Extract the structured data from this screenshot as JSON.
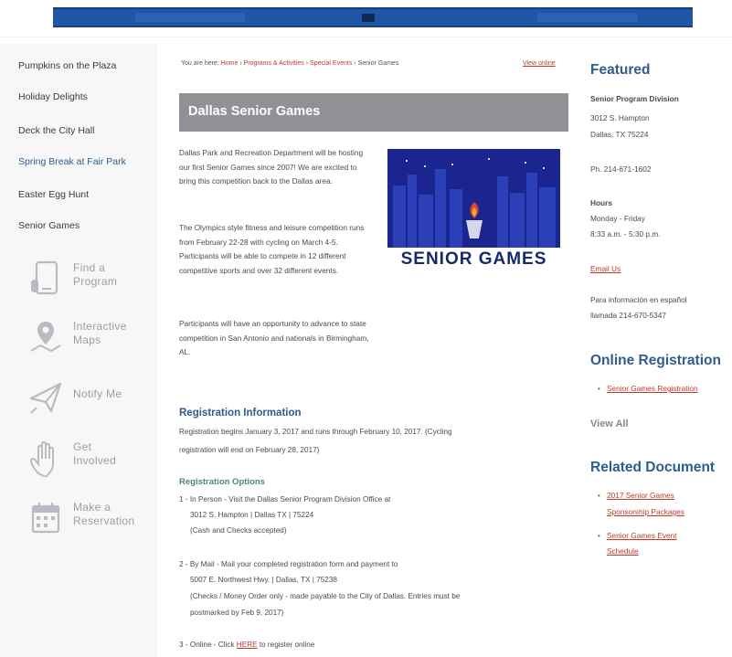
{
  "topbar": {
    "segments": [
      "",
      "",
      ""
    ]
  },
  "sidebar": {
    "links": [
      {
        "label": "Pumpkins on the Plaza"
      },
      {
        "label": "Holiday Delights"
      },
      {
        "label": "Deck the City Hall"
      },
      {
        "label": "Spring Break at Fair Park"
      },
      {
        "label": "Easter Egg Hunt"
      },
      {
        "label": "Senior Games"
      }
    ],
    "tiles": [
      {
        "line1": "Find a",
        "line2": "Program",
        "icon": "tablet-icon"
      },
      {
        "line1": "Interactive",
        "line2": "Maps",
        "icon": "map-pin-icon"
      },
      {
        "line1": "Notify Me",
        "line2": "",
        "icon": "paper-plane-icon"
      },
      {
        "line1": "Get",
        "line2": "Involved",
        "icon": "hand-icon"
      },
      {
        "line1": "Make a",
        "line2": "Reservation",
        "icon": "calendar-icon"
      }
    ]
  },
  "breadcrumb": {
    "prefix": "You are here:",
    "home": "Home",
    "sep": " › ",
    "programs": "Programs & Activities",
    "special": "Special Events",
    "current": "Senior Games",
    "view_online": "View online"
  },
  "main": {
    "title": "Dallas Senior Games",
    "intro_p1": "Dallas Park and Recreation Department will be hosting our first Senior Games since 2007! We are excited to bring this competition back to the Dallas area.",
    "intro_p2": "The Olympics style fitness and leisure competition runs from February 22-28 with cycling on March 4-5. Participants will be able to compete in 12 different competitive sports and over 32 different events.",
    "intro_p3": "Participants will have an opportunity to advance to state competition in San Antonio and nationals in Birmingham, AL.",
    "promo_wordmark": "SENIOR GAMES",
    "reg_heading": "Registration Information",
    "reg_line1": "Registration begins January 3, 2017 and runs through February 10, 2017. (Cycling",
    "reg_line2": "registration will end on February 28, 2017)",
    "options_heading": "Registration Options",
    "opt1_a": "1 - In Person - Visit the Dallas Senior Program Division Office at",
    "opt1_b": "3012 S. Hampton | Dallas TX | 75224",
    "opt1_c": "(Cash and Checks accepted)",
    "opt2_a": "2 - By Mail - Mail your completed registration form and payment to",
    "opt2_b": "5007 E. Northwest Hwy. | Dallas, TX | 75238",
    "opt2_c": "(Checks / Money Order only - made payable to the City of Dallas. Entries must be",
    "opt2_d": "postmarked by Feb 9, 2017)",
    "opt3_pre": "3 - Online - Click ",
    "opt3_link": "HERE",
    "opt3_post": " to register online"
  },
  "right": {
    "featured_heading": "Featured",
    "division": "Senior Program Division",
    "addr1": "3012 S. Hampton",
    "addr2": "Dallas, TX 75224",
    "phone": "Ph. 214-671-1602",
    "hours_heading": "Hours",
    "hours_days": "Monday - Friday",
    "hours_time": "8:33 a.m. - 5:30 p.m.",
    "email": "Email Us",
    "spanish1": "Para información en español",
    "spanish2": "llamada 214-670-5347",
    "online_heading": "Online Registration",
    "online_link": "Senior Games Registration",
    "view_all": "View All",
    "docs_heading": "Related Document",
    "doc1_a": "2017 Senior Games",
    "doc1_b": "Sponsorship Packages",
    "doc2_a": "Senior Games Event",
    "doc2_b": "Schedule",
    "bullet": "•"
  },
  "colors": {
    "accent": "#2f5c8f",
    "link": "#c0392b",
    "title_bar": "#8f9194",
    "topbar": "#1f57a6"
  }
}
